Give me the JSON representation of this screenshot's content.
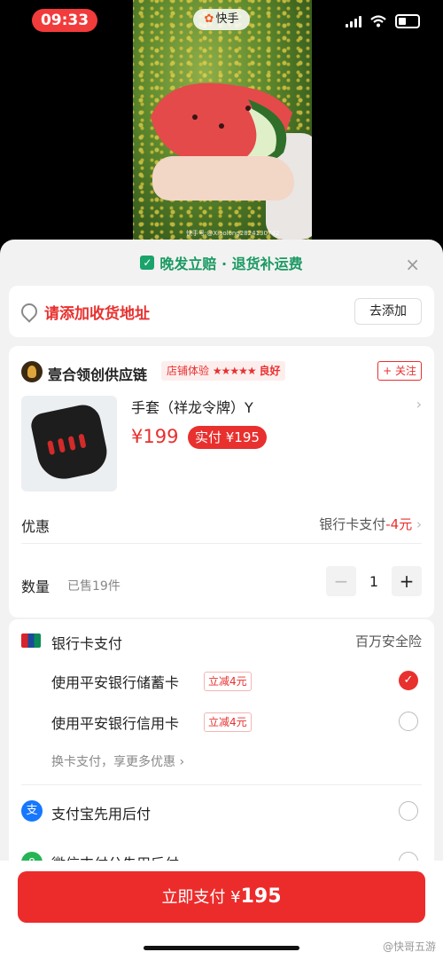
{
  "status": {
    "time": "09:33",
    "app": "快手"
  },
  "video": {
    "watermark": "快手号:@Xiaolong2824130742"
  },
  "notice": {
    "text": "晚发立赔 · 退货补运费",
    "close": "×"
  },
  "address": {
    "label": "请添加收货地址",
    "button": "去添加"
  },
  "shop": {
    "name": "壹合领创供应链",
    "badge_label": "店铺体验",
    "stars": "★★★★★",
    "grade": "良好",
    "follow": "+ 关注"
  },
  "product": {
    "title": "手套（祥龙令牌）Y",
    "price": "¥199",
    "pay_tag": "实付 ¥195"
  },
  "discount": {
    "label": "优惠",
    "value": "银行卡支付",
    "value_red": "-4元"
  },
  "quantity": {
    "label": "数量",
    "sold": "已售19件",
    "value": "1",
    "minus": "−",
    "plus": "+"
  },
  "payment": {
    "header": "银行卡支付",
    "insurance": "百万安全险",
    "options": [
      {
        "label": "使用平安银行储蓄卡",
        "tag": "立减4元",
        "selected": true
      },
      {
        "label": "使用平安银行信用卡",
        "tag": "立减4元",
        "selected": false
      }
    ],
    "more": "换卡支付，享更多优惠",
    "alipay": {
      "label": "支付宝先用后付",
      "icon": "支"
    },
    "wechat": {
      "label": "微信支付分先用后付",
      "icon": "8"
    }
  },
  "footer": {
    "pay_label": "立即支付 ¥",
    "pay_amount": "195",
    "watermark": "@快哥五游"
  },
  "colors": {
    "accent": "#e8302e",
    "green": "#1a9a62",
    "pay_button": "#ec2c2b"
  }
}
